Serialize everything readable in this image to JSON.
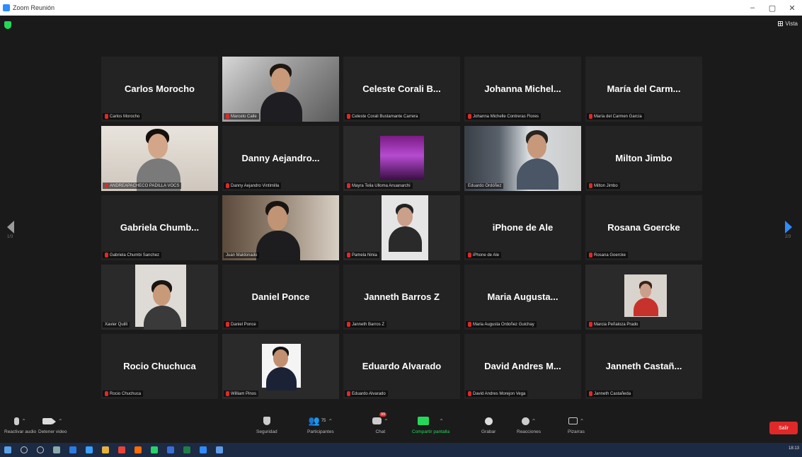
{
  "window": {
    "title": "Zoom Reunión",
    "controls": [
      "–",
      "▢",
      "✕"
    ]
  },
  "meeting": {
    "view_label": "Vista",
    "page_left": "1/3",
    "page_right": "2/3",
    "tiles": [
      {
        "display": "Carlos  Morocho",
        "label": "Carlos  Morocho",
        "video": ""
      },
      {
        "display": "",
        "label": "Marcelo Calle",
        "video": "stairs"
      },
      {
        "display": "Celeste Corali B...",
        "label": "Celeste Corali Bustamante Carrera",
        "video": ""
      },
      {
        "display": "Johanna Michel...",
        "label": "Johanna Michelle Contreras Flores",
        "video": ""
      },
      {
        "display": "María del Carm...",
        "label": "María del Carmen García",
        "video": ""
      },
      {
        "display": "",
        "label": "ANDREAPACHECO PADILLA VOCS",
        "video": "wall"
      },
      {
        "display": "Danny Aejandro...",
        "label": "Danny Aejandro Vintimilla",
        "video": ""
      },
      {
        "display": "",
        "label": "Mayra Telia Ulloma Anuanarchi",
        "video": "purple"
      },
      {
        "display": "",
        "label": "Eduardo Ordóñez",
        "video": "books"
      },
      {
        "display": "Milton Jimbo",
        "label": "Milton Jimbo",
        "video": ""
      },
      {
        "display": "Gabriela  Chumb...",
        "label": "Gabriela Chumbi Sanchez",
        "video": ""
      },
      {
        "display": "",
        "label": "Juan Maldonado",
        "video": "office",
        "active": true
      },
      {
        "display": "",
        "label": "Pamela Ninia",
        "video": "figure"
      },
      {
        "display": "iPhone de Ale",
        "label": "iPhone de Ale",
        "video": ""
      },
      {
        "display": "Rosana Goercke",
        "label": "Rosana Goercke",
        "video": ""
      },
      {
        "display": "",
        "label": "Xavier Quilli",
        "video": "portrait"
      },
      {
        "display": "Daniel Ponce",
        "label": "Daniel Ponce",
        "video": ""
      },
      {
        "display": "Janneth Barros Z",
        "label": "Janneth Barros Z",
        "video": ""
      },
      {
        "display": "Maria  Augusta...",
        "label": "Maria Augusta Ordoñez Guichay",
        "video": ""
      },
      {
        "display": "",
        "label": "Marcia Peñaloza Prado",
        "video": "red"
      },
      {
        "display": "Rocio Chuchuca",
        "label": "Rocio Chuchuca",
        "video": ""
      },
      {
        "display": "",
        "label": "William Pinos",
        "video": "suit"
      },
      {
        "display": "Eduardo Alvarado",
        "label": "Eduardo Alvarado",
        "video": ""
      },
      {
        "display": "David Andres M...",
        "label": "David Andres Morejon Vega",
        "video": ""
      },
      {
        "display": "Janneth  Castañ...",
        "label": "Janneth Castañeda",
        "video": ""
      }
    ]
  },
  "toolbar": {
    "audio": "Reactivar audio",
    "video": "Detener video",
    "security": "Seguridad",
    "participants": "Participantes",
    "participants_count": "75",
    "chat": "Chat",
    "chat_badge": "99",
    "share": "Compartir pantalla",
    "record": "Grabar",
    "reactions": "Reacciones",
    "apps": "Pizarras",
    "leave": "Salir"
  },
  "taskbar": {
    "time": "18:13"
  }
}
